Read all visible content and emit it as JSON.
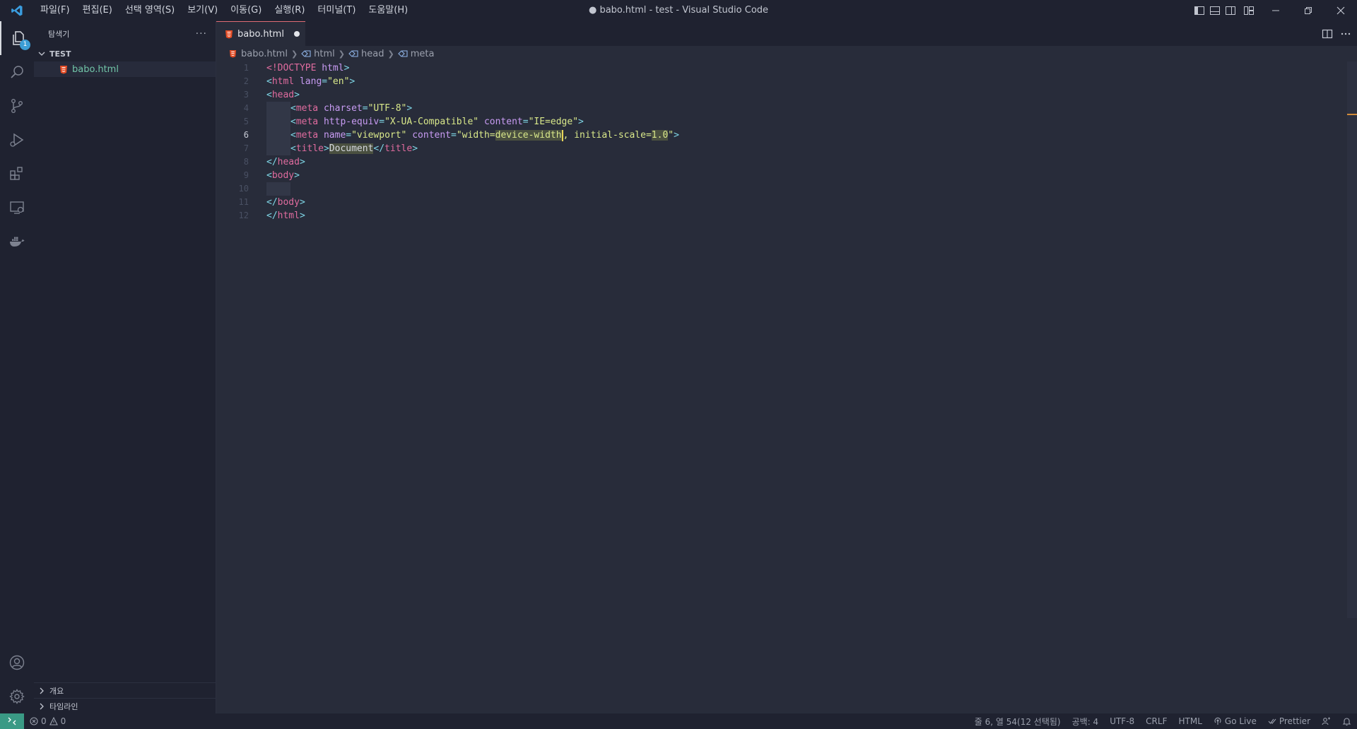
{
  "window": {
    "title": "● babo.html - test - Visual Studio Code",
    "menu": [
      "파일(F)",
      "편집(E)",
      "선택 영역(S)",
      "보기(V)",
      "이동(G)",
      "실행(R)",
      "터미널(T)",
      "도움말(H)"
    ]
  },
  "activity": {
    "explorer_badge": "1",
    "items": [
      "explorer-icon",
      "search-icon",
      "source-control-icon",
      "run-debug-icon",
      "extensions-icon",
      "remote-explorer-icon",
      "docker-icon",
      "account-icon",
      "gear-icon"
    ]
  },
  "sidebar": {
    "title": "탐색기",
    "more": "···",
    "folder": "TEST",
    "files": [
      {
        "name": "babo.html"
      }
    ],
    "outline": "개요",
    "timeline": "타임라인"
  },
  "editor": {
    "tab": {
      "label": "babo.html",
      "dirty": true
    },
    "breadcrumb": [
      "babo.html",
      "html",
      "head",
      "meta"
    ],
    "current_line": 6,
    "lines": [
      {
        "n": "1"
      },
      {
        "n": "2"
      },
      {
        "n": "3"
      },
      {
        "n": "4"
      },
      {
        "n": "5"
      },
      {
        "n": "6"
      },
      {
        "n": "7"
      },
      {
        "n": "8"
      },
      {
        "n": "9"
      },
      {
        "n": "10"
      },
      {
        "n": "11"
      },
      {
        "n": "12"
      }
    ],
    "code": {
      "l1_doctype": "<!DOCTYPE",
      "l1_html": " html",
      "l1_close": ">",
      "l2_open": "<",
      "l2_tag": "html",
      "l2_attr": " lang",
      "l2_eq": "=",
      "l2_val": "\"en\"",
      "l2_close": ">",
      "l3_open": "<",
      "l3_tag": "head",
      "l3_close": ">",
      "l4_open": "<",
      "l4_tag": "meta",
      "l4_attr": " charset",
      "l4_eq": "=",
      "l4_val": "\"UTF-8\"",
      "l4_close": ">",
      "l5_open": "<",
      "l5_tag": "meta",
      "l5_attr1": " http-equiv",
      "l5_eq1": "=",
      "l5_val1": "\"X-UA-Compatible\"",
      "l5_attr2": " content",
      "l5_eq2": "=",
      "l5_val2": "\"IE=edge\"",
      "l5_close": ">",
      "l6_open": "<",
      "l6_tag": "meta",
      "l6_attr1": " name",
      "l6_eq1": "=",
      "l6_val1": "\"viewport\"",
      "l6_attr2": " content",
      "l6_eq2": "=",
      "l6_val2a": "\"width=",
      "l6_val2b": "device-width",
      "l6_val2c": ", initial-scale=",
      "l6_val2d": "1.0",
      "l6_val2e": "\"",
      "l6_close": ">",
      "l7_open": "<",
      "l7_tag": "title",
      "l7_close1": ">",
      "l7_text": "Document",
      "l7_open2": "</",
      "l7_tag2": "title",
      "l7_close2": ">",
      "l8_open": "</",
      "l8_tag": "head",
      "l8_close": ">",
      "l9_open": "<",
      "l9_tag": "body",
      "l9_close": ">",
      "l11_open": "</",
      "l11_tag": "body",
      "l11_close": ">",
      "l12_open": "</",
      "l12_tag": "html",
      "l12_close": ">"
    }
  },
  "status": {
    "errors": "0",
    "warnings": "0",
    "position": "줄 6, 열 54(12 선택됨)",
    "spaces": "공백: 4",
    "encoding": "UTF-8",
    "eol": "CRLF",
    "language": "HTML",
    "golive": "Go Live",
    "prettier": "Prettier"
  },
  "colors": {
    "accent": "#3a9a85",
    "html_icon": "#e44d26",
    "file_green": "#71c5a8"
  }
}
